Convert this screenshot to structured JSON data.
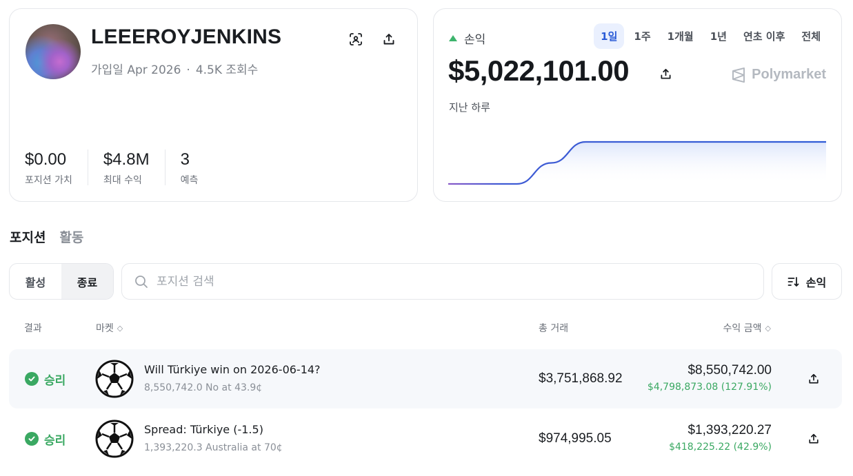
{
  "profile": {
    "username": "LEEEROYJENKINS",
    "joined": "가입일 Apr 2026",
    "separator": "·",
    "views": "4.5K 조회수",
    "stats": [
      {
        "value": "$0.00",
        "label": "포지션 가치"
      },
      {
        "value": "$4.8M",
        "label": "최대 수익"
      },
      {
        "value": "3",
        "label": "예측"
      }
    ]
  },
  "pnl": {
    "label": "손익",
    "ranges": [
      "1일",
      "1주",
      "1개월",
      "1년",
      "연초 이후",
      "전체"
    ],
    "active_range": "1일",
    "value": "$5,022,101.00",
    "brand": "Polymarket",
    "period_label": "지난 하루",
    "line_color": "#2f5bd6",
    "series": [
      0,
      0,
      0,
      0.5,
      1,
      1,
      1,
      1,
      1,
      1,
      1,
      1
    ]
  },
  "tabs": [
    "포지션",
    "활동"
  ],
  "filters": {
    "segments": [
      "활성",
      "종료"
    ],
    "active_segment": "종료",
    "search_placeholder": "포지션 검색",
    "sort_label": "손익"
  },
  "table": {
    "headers": {
      "result": "결과",
      "market": "마켓",
      "volume": "총 거래",
      "amount": "수익 금액"
    },
    "rows": [
      {
        "result": "승리",
        "title": "Will Türkiye win on 2026-06-14?",
        "sub": "8,550,742.0 No at 43.9¢",
        "volume": "$3,751,868.92",
        "amount": "$8,550,742.00",
        "gain": "$4,798,873.08 (127.91%)"
      },
      {
        "result": "승리",
        "title": "Spread: Türkiye (-1.5)",
        "sub": "1,393,220.3 Australia at 70¢",
        "volume": "$974,995.05",
        "amount": "$1,393,220.27",
        "gain": "$418,225.22 (42.9%)"
      }
    ]
  },
  "colors": {
    "accent": "#2a5bd7",
    "positive": "#3aa862"
  }
}
